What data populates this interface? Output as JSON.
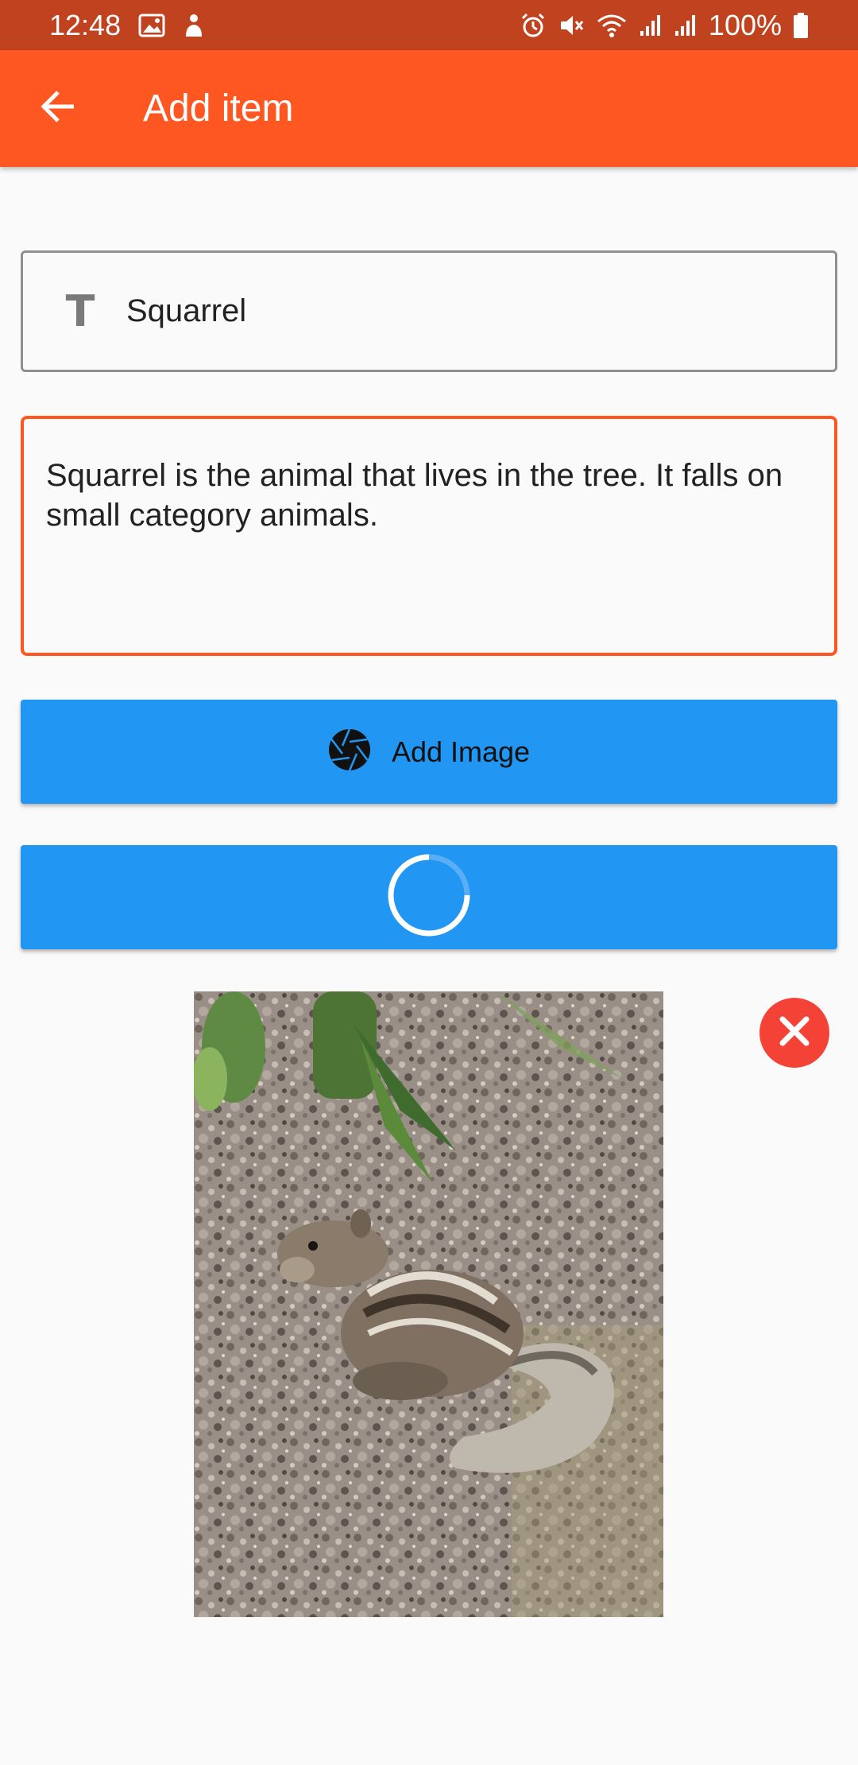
{
  "status_bar": {
    "time": "12:48",
    "battery": "100%",
    "icons_left": [
      "gallery-icon",
      "person-icon"
    ],
    "icons_right": [
      "alarm-icon",
      "mute-icon",
      "wifi-icon",
      "signal-icon",
      "signal-icon",
      "battery-icon"
    ]
  },
  "app_bar": {
    "title": "Add item",
    "back_icon": "arrow-back-icon"
  },
  "form": {
    "title_icon_glyph": "T",
    "title_value": "Squarrel",
    "description_value": "Squarrel is the animal that lives in the tree. It falls on small category animals.",
    "add_image_label": "Add Image",
    "add_image_icon": "camera-shutter-icon",
    "loading_icon": "spinner-icon"
  },
  "image": {
    "subject": "squirrel photo",
    "remove_icon": "close-icon"
  },
  "colors": {
    "status_bar": "#c0421e",
    "app_bar": "#ff5722",
    "accent": "#ff5722",
    "button": "#2196f3",
    "remove": "#f44336",
    "background": "#fafafa"
  }
}
